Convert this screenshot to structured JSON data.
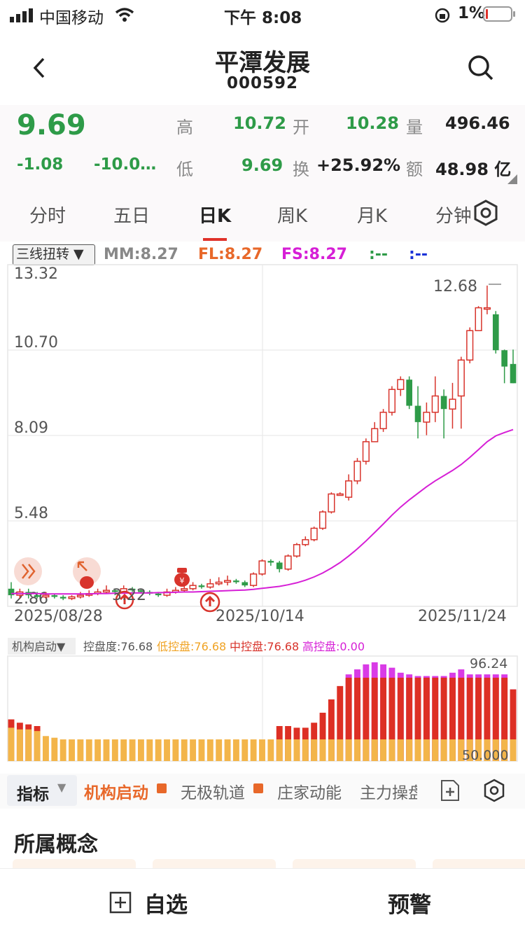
{
  "status_bar": {
    "carrier": "中国移动",
    "time": "下午 8:08",
    "battery": "1%"
  },
  "header": {
    "title": "平潭发展",
    "code": "000592",
    "back_icon": "chevron-left-icon",
    "search_icon": "search-icon"
  },
  "quote": {
    "price": "9.69",
    "change": "-1.08",
    "change_pct": "-10.0…",
    "high_label": "高",
    "high": "10.72",
    "open_label": "开",
    "open": "10.28",
    "volume_label": "量",
    "volume": "496.46",
    "low_label": "低",
    "low": "9.69",
    "turnover_label": "换",
    "turnover": "+25.92%",
    "amount_label": "额",
    "amount": "48.98 亿"
  },
  "tabs": [
    "分时",
    "五日",
    "日K",
    "周K",
    "月K",
    "分钟"
  ],
  "active_tab": "日K",
  "kline": {
    "indicator_select": "三线扭转 ▼",
    "mm": "MM:8.27",
    "fl": "FL:8.27",
    "fs": "FS:8.27",
    "green_legend": ":--",
    "blue_legend": ":--",
    "y_ticks": [
      "13.32",
      "10.70",
      "8.09",
      "5.48",
      "2.86"
    ],
    "x_ticks": [
      "2025/08/28",
      "2025/10/14",
      "2025/11/24"
    ],
    "high_marker": "12.68",
    "low_marker": "3.22",
    "colors": {
      "up": "#d8342c",
      "down": "#2e9b48",
      "line": "#d61fd6"
    }
  },
  "lower_indicator": {
    "select": "机构启动▼",
    "control_degree": "控盘度:76.68",
    "low_control": "低控盘:76.68",
    "mid_control": "中控盘:76.68",
    "high_control": "高控盘:0.00",
    "top_value": "96.24",
    "base_value": "50.000"
  },
  "chart_data": {
    "type": "bar",
    "title": "",
    "candles": [
      [
        3.4,
        3.2,
        3.6,
        3.1
      ],
      [
        3.2,
        3.3,
        3.4,
        3.1
      ],
      [
        3.3,
        3.2,
        3.4,
        3.1
      ],
      [
        3.2,
        3.15,
        3.3,
        3.1
      ],
      [
        3.15,
        3.2,
        3.3,
        3.1
      ],
      [
        3.2,
        3.15,
        3.25,
        3.1
      ],
      [
        3.15,
        3.1,
        3.2,
        3.05
      ],
      [
        3.1,
        3.15,
        3.2,
        3.05
      ],
      [
        3.15,
        3.2,
        3.3,
        3.1
      ],
      [
        3.2,
        3.25,
        3.35,
        3.15
      ],
      [
        3.25,
        3.3,
        3.4,
        3.2
      ],
      [
        3.3,
        3.35,
        3.5,
        3.25
      ],
      [
        3.35,
        3.3,
        3.4,
        3.2
      ],
      [
        3.3,
        3.4,
        3.5,
        3.25
      ],
      [
        3.4,
        3.35,
        3.45,
        3.3
      ],
      [
        3.35,
        3.3,
        3.4,
        3.25
      ],
      [
        3.3,
        3.25,
        3.35,
        3.2
      ],
      [
        3.25,
        3.2,
        3.3,
        3.15
      ],
      [
        3.2,
        3.3,
        3.4,
        3.15
      ],
      [
        3.3,
        3.35,
        3.45,
        3.25
      ],
      [
        3.35,
        3.4,
        3.5,
        3.3
      ],
      [
        3.4,
        3.5,
        3.6,
        3.35
      ],
      [
        3.5,
        3.45,
        3.55,
        3.4
      ],
      [
        3.45,
        3.55,
        3.7,
        3.4
      ],
      [
        3.55,
        3.6,
        3.75,
        3.5
      ],
      [
        3.6,
        3.65,
        3.8,
        3.5
      ],
      [
        3.65,
        3.6,
        3.7,
        3.55
      ],
      [
        3.6,
        3.5,
        3.65,
        3.45
      ],
      [
        3.5,
        3.85,
        3.9,
        3.45
      ],
      [
        3.85,
        4.25,
        4.3,
        3.8
      ],
      [
        4.25,
        4.2,
        4.3,
        4.1
      ],
      [
        4.2,
        4.0,
        4.25,
        3.9
      ],
      [
        4.0,
        4.4,
        4.45,
        3.95
      ],
      [
        4.4,
        4.75,
        4.8,
        4.35
      ],
      [
        4.75,
        4.9,
        5.0,
        4.7
      ],
      [
        4.9,
        5.25,
        5.3,
        4.85
      ],
      [
        5.25,
        5.75,
        5.8,
        5.2
      ],
      [
        5.75,
        6.3,
        6.35,
        5.7
      ],
      [
        6.3,
        6.3,
        6.35,
        6.25
      ],
      [
        6.2,
        6.7,
        6.9,
        6.1
      ],
      [
        6.7,
        7.3,
        7.4,
        6.6
      ],
      [
        7.3,
        7.9,
        8.0,
        7.2
      ],
      [
        7.9,
        8.3,
        8.5,
        7.9
      ],
      [
        8.3,
        8.8,
        8.9,
        8.2
      ],
      [
        8.8,
        9.5,
        9.6,
        8.7
      ],
      [
        9.5,
        9.8,
        9.9,
        9.3
      ],
      [
        9.8,
        9.0,
        9.9,
        8.9
      ],
      [
        9.0,
        8.5,
        9.6,
        8.0
      ],
      [
        8.5,
        8.8,
        9.1,
        8.1
      ],
      [
        8.8,
        9.3,
        9.9,
        8.5
      ],
      [
        9.3,
        8.9,
        9.5,
        8.0
      ],
      [
        8.9,
        9.2,
        9.7,
        8.3
      ],
      [
        9.3,
        10.4,
        10.5,
        8.3
      ],
      [
        10.4,
        11.3,
        11.4,
        10.3
      ],
      [
        11.3,
        12.0,
        12.05,
        11.3
      ],
      [
        12.0,
        12.0,
        12.68,
        11.8
      ],
      [
        11.8,
        10.7,
        11.9,
        10.6
      ],
      [
        10.7,
        10.2,
        10.72,
        9.69
      ],
      [
        10.28,
        9.69,
        10.72,
        9.69
      ]
    ],
    "ma": [
      3.25,
      3.25,
      3.25,
      3.25,
      3.24,
      3.24,
      3.24,
      3.24,
      3.24,
      3.24,
      3.25,
      3.25,
      3.26,
      3.26,
      3.27,
      3.27,
      3.27,
      3.28,
      3.28,
      3.29,
      3.3,
      3.3,
      3.31,
      3.32,
      3.33,
      3.34,
      3.35,
      3.36,
      3.38,
      3.41,
      3.44,
      3.47,
      3.52,
      3.58,
      3.66,
      3.76,
      3.88,
      4.03,
      4.2,
      4.4,
      4.62,
      4.86,
      5.12,
      5.38,
      5.65,
      5.9,
      6.12,
      6.32,
      6.52,
      6.7,
      6.86,
      7.02,
      7.2,
      7.42,
      7.66,
      7.9,
      8.08,
      8.18,
      8.27
    ],
    "ylim": [
      2.86,
      13.32
    ],
    "x_labels": [
      "2025/08/28",
      "2025/10/14",
      "2025/11/24"
    ],
    "lower_series": [
      {
        "name": "低控盘",
        "values": [
          57,
          56,
          56,
          55,
          52,
          51,
          50,
          50,
          50,
          50,
          50,
          50,
          50,
          50,
          50,
          50,
          50,
          50,
          50,
          50,
          50,
          50,
          50,
          50,
          50,
          50,
          50,
          50,
          50,
          50,
          50,
          50,
          50,
          50,
          50,
          50,
          50,
          50,
          50,
          50,
          50,
          50,
          50,
          50,
          50,
          50,
          50,
          50,
          50,
          50,
          50,
          50,
          50,
          50,
          50,
          50,
          50,
          50,
          50
        ]
      },
      {
        "name": "中控盘",
        "values": [
          62,
          60,
          59,
          58,
          0,
          0,
          0,
          0,
          0,
          0,
          0,
          0,
          0,
          0,
          0,
          0,
          0,
          0,
          0,
          0,
          0,
          0,
          0,
          0,
          0,
          0,
          0,
          0,
          0,
          0,
          0,
          58,
          58,
          57,
          57,
          60,
          66,
          74,
          82,
          87,
          87,
          87,
          87,
          87,
          87,
          87,
          87,
          87,
          87,
          87,
          87,
          87,
          87,
          87,
          87,
          87,
          87,
          87,
          80
        ]
      },
      {
        "name": "高控盘",
        "values": [
          0,
          0,
          0,
          0,
          0,
          0,
          0,
          0,
          0,
          0,
          0,
          0,
          0,
          0,
          0,
          0,
          0,
          0,
          0,
          0,
          0,
          0,
          0,
          0,
          0,
          0,
          0,
          0,
          0,
          0,
          0,
          0,
          0,
          0,
          0,
          0,
          0,
          0,
          0,
          89,
          92,
          95,
          96.24,
          95,
          93,
          90,
          89,
          88,
          88,
          88,
          88,
          90,
          92,
          89,
          89,
          89,
          89,
          89,
          80
        ]
      }
    ],
    "lower_ylim": [
      37,
      100
    ]
  },
  "indicator_tabs": {
    "selector": "指标",
    "items": [
      "机构启动",
      "无极轨道",
      "庄家动能",
      "主力操盘"
    ]
  },
  "concept": {
    "title": "所属概念"
  },
  "bottom": {
    "watchlist": "自选",
    "alert": "预警"
  }
}
